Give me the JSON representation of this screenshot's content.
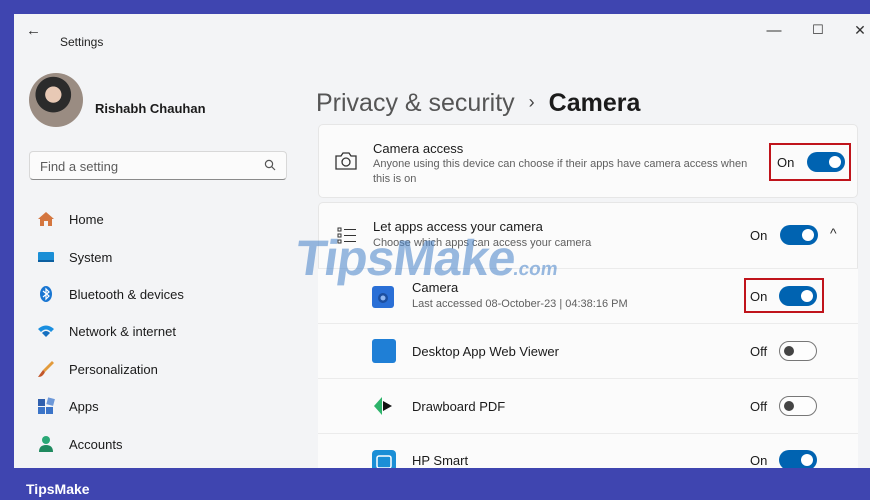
{
  "window": {
    "back_glyph": "←",
    "title": "Settings",
    "minimize_glyph": "—",
    "maximize_glyph": "☐",
    "close_glyph": "✕"
  },
  "user": {
    "name": "Rishabh Chauhan"
  },
  "search": {
    "placeholder": "Find a setting"
  },
  "sidebar": {
    "items": [
      {
        "label": "Home",
        "icon": "home-icon"
      },
      {
        "label": "System",
        "icon": "system-icon"
      },
      {
        "label": "Bluetooth & devices",
        "icon": "bluetooth-icon"
      },
      {
        "label": "Network & internet",
        "icon": "wifi-icon"
      },
      {
        "label": "Personalization",
        "icon": "brush-icon"
      },
      {
        "label": "Apps",
        "icon": "apps-icon"
      },
      {
        "label": "Accounts",
        "icon": "accounts-icon"
      }
    ]
  },
  "breadcrumb": {
    "parent": "Privacy & security",
    "separator": "›",
    "current": "Camera"
  },
  "camera_access": {
    "title": "Camera access",
    "description": "Anyone using this device can choose if their apps have camera access when this is on",
    "state": "On"
  },
  "let_apps": {
    "title": "Let apps access your camera",
    "description": "Choose which apps can access your camera",
    "state": "On",
    "chevron": "^"
  },
  "apps": [
    {
      "name": "Camera",
      "detail": "Last accessed 08-October-23  |  04:38:16 PM",
      "state": "On"
    },
    {
      "name": "Desktop App Web Viewer",
      "state": "Off"
    },
    {
      "name": "Drawboard PDF",
      "state": "Off"
    },
    {
      "name": "HP Smart",
      "state": "On"
    }
  ],
  "watermark": {
    "text": "TipsMake",
    "suffix": ".com"
  },
  "footer": {
    "brand": "TipsMake"
  },
  "colors": {
    "accent": "#0063b1",
    "highlight": "#c0141b",
    "banner": "#3f45b0"
  }
}
